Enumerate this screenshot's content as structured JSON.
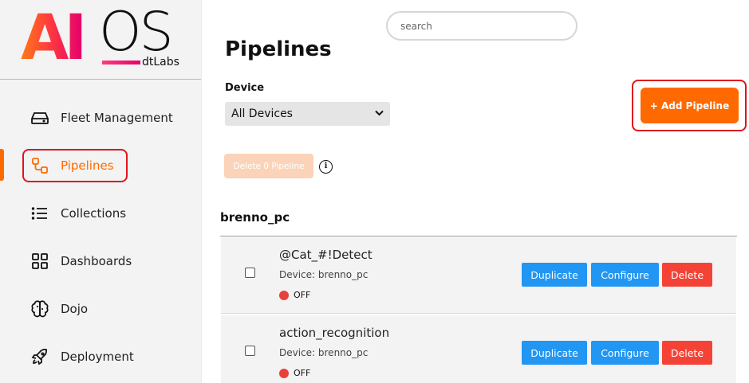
{
  "brand": {
    "logo_primary": "AI",
    "logo_secondary": "OS",
    "logo_sub": "dtLabs",
    "accent_color": "#ff6a00"
  },
  "sidebar": {
    "items": [
      {
        "label": "Fleet Management",
        "icon": "drive-icon"
      },
      {
        "label": "Pipelines",
        "icon": "pipeline-icon",
        "active": true
      },
      {
        "label": "Collections",
        "icon": "list-icon"
      },
      {
        "label": "Dashboards",
        "icon": "grid-icon"
      },
      {
        "label": "Dojo",
        "icon": "brain-icon"
      },
      {
        "label": "Deployment",
        "icon": "rocket-icon"
      }
    ]
  },
  "search": {
    "placeholder": "search"
  },
  "page": {
    "title": "Pipelines",
    "device_label": "Device",
    "device_selected": "All Devices",
    "add_button": "+ Add Pipeline",
    "delete_selected": "Delete 0 Pipeline"
  },
  "groups": [
    {
      "name": "brenno_pc",
      "pipelines": [
        {
          "name": "@Cat_#!Detect",
          "device": "Device: brenno_pc",
          "status": "OFF",
          "status_color": "#e8413a"
        },
        {
          "name": "action_recognition",
          "device": "Device: brenno_pc",
          "status": "OFF",
          "status_color": "#e8413a"
        }
      ]
    }
  ],
  "actions": {
    "duplicate": "Duplicate",
    "configure": "Configure",
    "delete": "Delete"
  },
  "colors": {
    "primary_blue": "#2196f3",
    "danger_red": "#f44336",
    "highlight_red": "#e0141e"
  }
}
